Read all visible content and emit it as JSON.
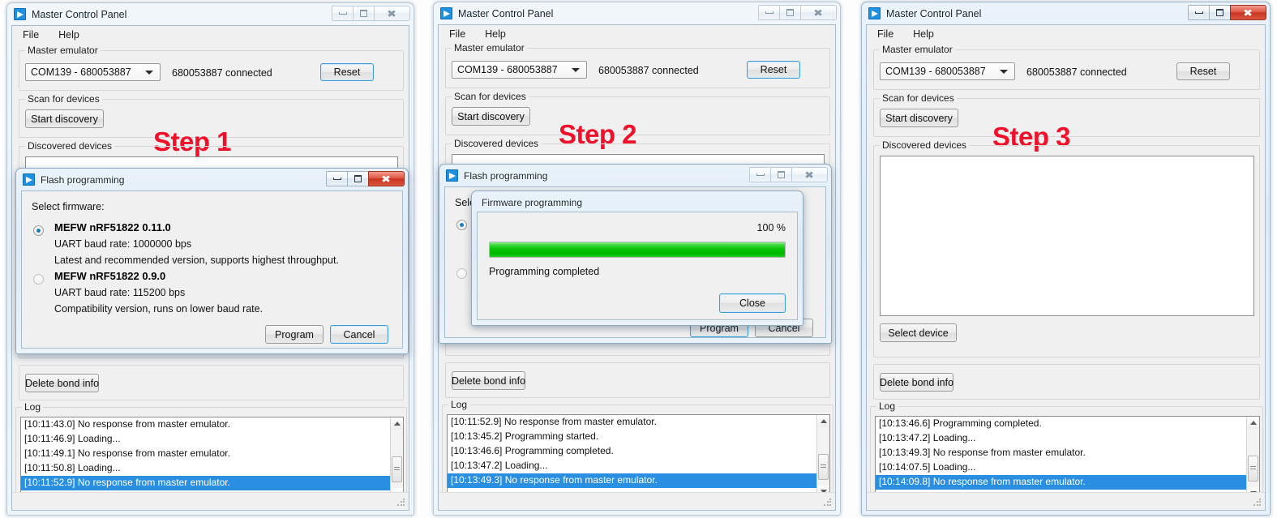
{
  "app": {
    "title": "Master Control Panel",
    "icon": "nordic-app-icon",
    "menu": [
      "File",
      "Help"
    ]
  },
  "groups": {
    "master_emulator": "Master emulator",
    "scan_for_devices": "Scan for devices",
    "discovered_devices": "Discovered devices",
    "log": "Log"
  },
  "controls": {
    "com_port": "COM139 - 680053887",
    "connected_status": "680053887 connected",
    "reset": "Reset",
    "start_discovery": "Start discovery",
    "select_device": "Select device",
    "delete_bond_info": "Delete bond info"
  },
  "window_buttons": {
    "minimize": "minimize-button",
    "maximize": "maximize-button",
    "close": "close-button"
  },
  "panels": [
    {
      "step_label": "Step 1",
      "window_active": false,
      "log": [
        {
          "text": "[10:11:43.0] No response from master emulator.",
          "selected": false
        },
        {
          "text": "[10:11:46.9] Loading...",
          "selected": false
        },
        {
          "text": "[10:11:49.1] No response from master emulator.",
          "selected": false
        },
        {
          "text": "[10:11:50.8] Loading...",
          "selected": false
        },
        {
          "text": "[10:11:52.9] No response from master emulator.",
          "selected": true
        }
      ]
    },
    {
      "step_label": "Step 2",
      "window_active": false,
      "log": [
        {
          "text": "[10:11:52.9] No response from master emulator.",
          "selected": false
        },
        {
          "text": "[10:13:45.2] Programming started.",
          "selected": false
        },
        {
          "text": "[10:13:46.6] Programming completed.",
          "selected": false
        },
        {
          "text": "[10:13:47.2] Loading...",
          "selected": false
        },
        {
          "text": "[10:13:49.3] No response from master emulator.",
          "selected": true
        }
      ]
    },
    {
      "step_label": "Step 3",
      "window_active": true,
      "log": [
        {
          "text": "[10:13:46.6] Programming completed.",
          "selected": false
        },
        {
          "text": "[10:13:47.2] Loading...",
          "selected": false
        },
        {
          "text": "[10:13:49.3] No response from master emulator.",
          "selected": false
        },
        {
          "text": "[10:14:07.5] Loading...",
          "selected": false
        },
        {
          "text": "[10:14:09.8] No response from master emulator.",
          "selected": true
        }
      ]
    }
  ],
  "flash_dialog": {
    "title": "Flash programming",
    "prompt": "Select firmware:",
    "options": [
      {
        "name": "MEFW nRF51822 0.11.0",
        "baud": "UART baud rate: 1000000 bps",
        "note": "Latest and recommended version, supports highest throughput.",
        "selected": true
      },
      {
        "name": "MEFW nRF51822 0.9.0",
        "baud": "UART baud rate: 115200 bps",
        "note": "Compatibility version, runs on lower baud rate.",
        "selected": false
      }
    ],
    "program_button": "Program",
    "cancel_button": "Cancel"
  },
  "firmware_dialog": {
    "title": "Firmware programming",
    "percent": "100 %",
    "progress_value": 100,
    "status": "Programming completed",
    "close_button": "Close"
  },
  "colors": {
    "step_red": "#f0102a",
    "selection_blue": "#2a8fe0",
    "progress_green": "#07c507",
    "close_red": "#c8341f"
  }
}
